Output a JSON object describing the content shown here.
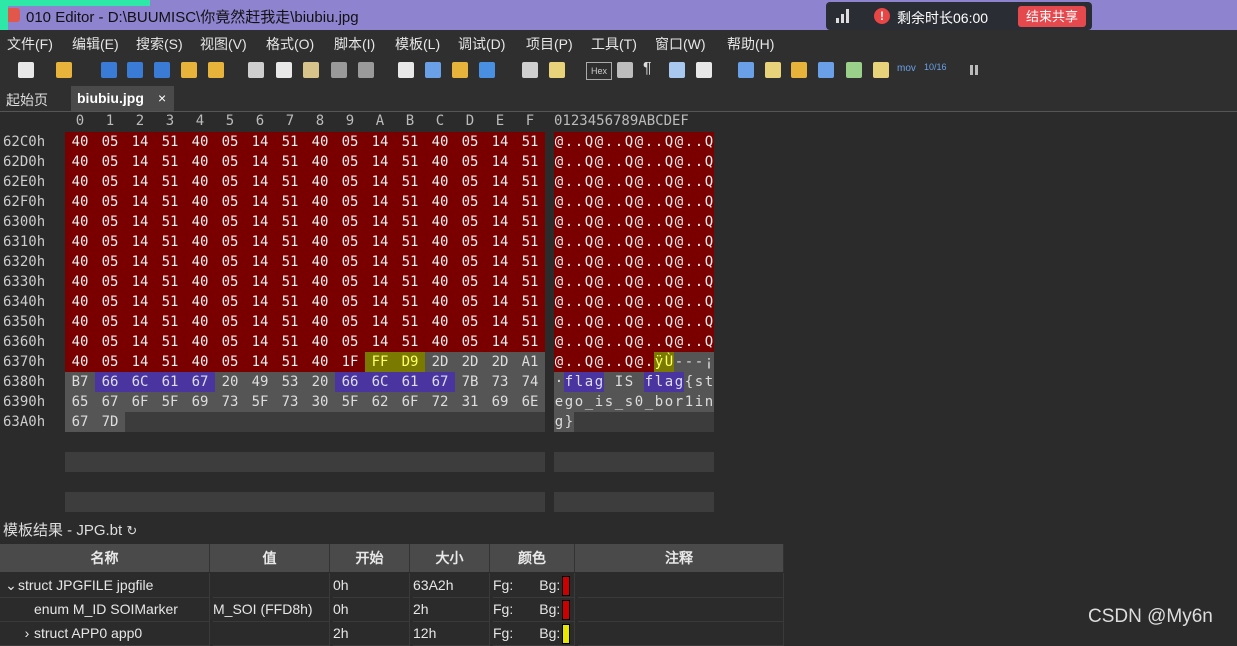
{
  "window": {
    "title": "010 Editor - D:\\BUUMISC\\你竟然赶我走\\biubiu.jpg"
  },
  "share_bar": {
    "remaining": "剩余时长06:00",
    "end_label": "结束共享",
    "info_glyph": "!"
  },
  "menu": [
    "文件(F)",
    "编辑(E)",
    "搜索(S)",
    "视图(V)",
    "格式(O)",
    "脚本(I)",
    "模板(L)",
    "调试(D)",
    "项目(P)",
    "工具(T)",
    "窗口(W)",
    "帮助(H)"
  ],
  "toolbar": {
    "hex_label": "Hex",
    "pilcrow_glyph": "¶",
    "mov_label": "mov",
    "base_label": "10/16"
  },
  "tabs": {
    "start": "起始页",
    "active": "biubiu.jpg",
    "close_glyph": "×"
  },
  "hex": {
    "columns": [
      "0",
      "1",
      "2",
      "3",
      "4",
      "5",
      "6",
      "7",
      "8",
      "9",
      "A",
      "B",
      "C",
      "D",
      "E",
      "F"
    ],
    "ascii_header": "0123456789ABCDEF",
    "addresses": [
      "62C0h",
      "62D0h",
      "62E0h",
      "62F0h",
      "6300h",
      "6310h",
      "6320h",
      "6330h",
      "6340h",
      "6350h",
      "6360h",
      "6370h",
      "6380h",
      "6390h",
      "63A0h"
    ],
    "rows": [
      [
        "40",
        "05",
        "14",
        "51",
        "40",
        "05",
        "14",
        "51",
        "40",
        "05",
        "14",
        "51",
        "40",
        "05",
        "14",
        "51"
      ],
      [
        "40",
        "05",
        "14",
        "51",
        "40",
        "05",
        "14",
        "51",
        "40",
        "05",
        "14",
        "51",
        "40",
        "05",
        "14",
        "51"
      ],
      [
        "40",
        "05",
        "14",
        "51",
        "40",
        "05",
        "14",
        "51",
        "40",
        "05",
        "14",
        "51",
        "40",
        "05",
        "14",
        "51"
      ],
      [
        "40",
        "05",
        "14",
        "51",
        "40",
        "05",
        "14",
        "51",
        "40",
        "05",
        "14",
        "51",
        "40",
        "05",
        "14",
        "51"
      ],
      [
        "40",
        "05",
        "14",
        "51",
        "40",
        "05",
        "14",
        "51",
        "40",
        "05",
        "14",
        "51",
        "40",
        "05",
        "14",
        "51"
      ],
      [
        "40",
        "05",
        "14",
        "51",
        "40",
        "05",
        "14",
        "51",
        "40",
        "05",
        "14",
        "51",
        "40",
        "05",
        "14",
        "51"
      ],
      [
        "40",
        "05",
        "14",
        "51",
        "40",
        "05",
        "14",
        "51",
        "40",
        "05",
        "14",
        "51",
        "40",
        "05",
        "14",
        "51"
      ],
      [
        "40",
        "05",
        "14",
        "51",
        "40",
        "05",
        "14",
        "51",
        "40",
        "05",
        "14",
        "51",
        "40",
        "05",
        "14",
        "51"
      ],
      [
        "40",
        "05",
        "14",
        "51",
        "40",
        "05",
        "14",
        "51",
        "40",
        "05",
        "14",
        "51",
        "40",
        "05",
        "14",
        "51"
      ],
      [
        "40",
        "05",
        "14",
        "51",
        "40",
        "05",
        "14",
        "51",
        "40",
        "05",
        "14",
        "51",
        "40",
        "05",
        "14",
        "51"
      ],
      [
        "40",
        "05",
        "14",
        "51",
        "40",
        "05",
        "14",
        "51",
        "40",
        "05",
        "14",
        "51",
        "40",
        "05",
        "14",
        "51"
      ],
      [
        "40",
        "05",
        "14",
        "51",
        "40",
        "05",
        "14",
        "51",
        "40",
        "1F",
        "FF",
        "D9",
        "2D",
        "2D",
        "2D",
        "A1"
      ],
      [
        "B7",
        "66",
        "6C",
        "61",
        "67",
        "20",
        "49",
        "53",
        "20",
        "66",
        "6C",
        "61",
        "67",
        "7B",
        "73",
        "74"
      ],
      [
        "65",
        "67",
        "6F",
        "5F",
        "69",
        "73",
        "5F",
        "73",
        "30",
        "5F",
        "62",
        "6F",
        "72",
        "31",
        "69",
        "6E"
      ],
      [
        "67",
        "7D"
      ]
    ],
    "ascii": [
      "@..Q@..Q@..Q@..Q",
      "@..Q@..Q@..Q@..Q",
      "@..Q@..Q@..Q@..Q",
      "@..Q@..Q@..Q@..Q",
      "@..Q@..Q@..Q@..Q",
      "@..Q@..Q@..Q@..Q",
      "@..Q@..Q@..Q@..Q",
      "@..Q@..Q@..Q@..Q",
      "@..Q@..Q@..Q@..Q",
      "@..Q@..Q@..Q@..Q",
      "@..Q@..Q@..Q@..Q",
      "@..Q@..Q@.ÿÙ---¡",
      "·flag IS flag{st",
      "ego_is_s0_bor1in",
      "g}"
    ],
    "colors": {
      "data": "#7a0000",
      "marker": "#7a7a00",
      "trailer": "#555555",
      "flag": "#4a35a0"
    }
  },
  "template_panel": {
    "title": "模板结果 - JPG.bt",
    "refresh_glyph": "↻",
    "headers": [
      "名称",
      "值",
      "开始",
      "大小",
      "颜色",
      "注释"
    ],
    "rows": [
      {
        "expander": "⌄",
        "name": "struct JPGFILE jpgfile",
        "value": "",
        "start": "0h",
        "size": "63A2h",
        "fg": "Fg:",
        "bg": "Bg:",
        "bg_color": "#cc0000"
      },
      {
        "expander": "",
        "name": "enum M_ID SOIMarker",
        "value": "M_SOI (FFD8h)",
        "start": "0h",
        "size": "2h",
        "fg": "Fg:",
        "bg": "Bg:",
        "bg_color": "#cc0000"
      },
      {
        "expander": "›",
        "name": "struct APP0 app0",
        "value": "",
        "start": "2h",
        "size": "12h",
        "fg": "Fg:",
        "bg": "Bg:",
        "bg_color": "#e6e600"
      }
    ]
  },
  "watermark": "CSDN @My6n"
}
